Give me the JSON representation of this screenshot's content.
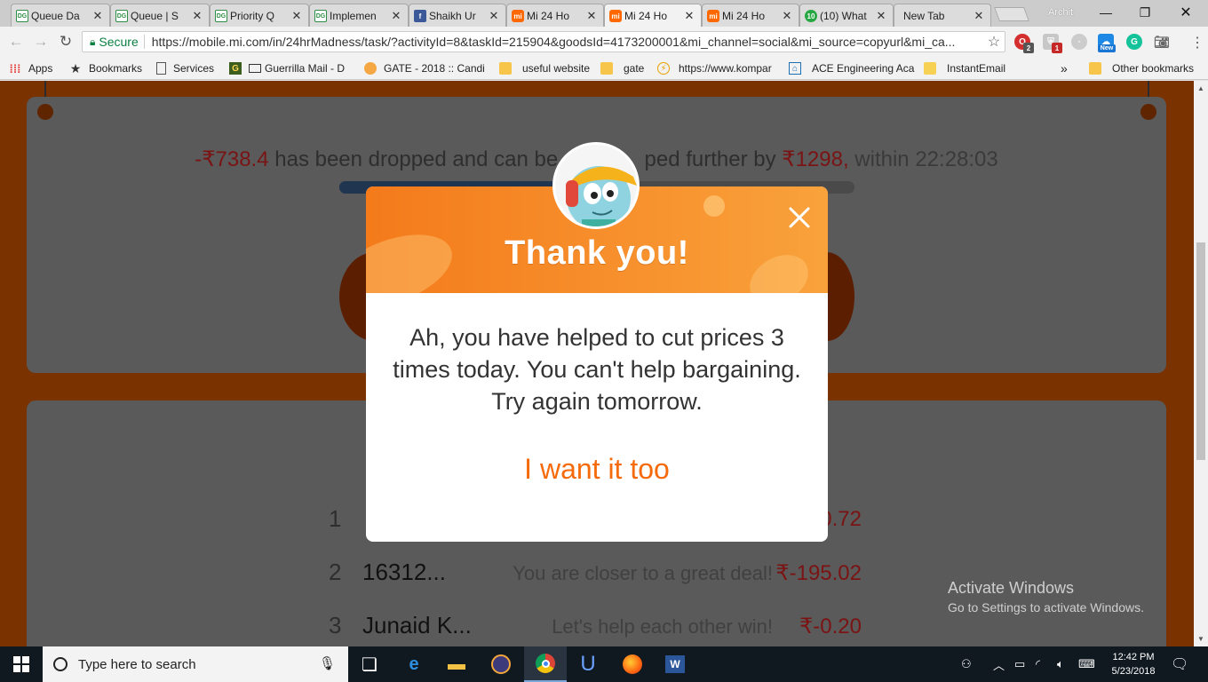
{
  "browser": {
    "tabs": [
      {
        "icon": "gfg-favicon",
        "title": "Queue Da"
      },
      {
        "icon": "gfg-favicon",
        "title": "Queue | S"
      },
      {
        "icon": "gfg-favicon",
        "title": "Priority Q"
      },
      {
        "icon": "gfg-favicon",
        "title": "Implemen"
      },
      {
        "icon": "facebook-favicon",
        "title": "Shaikh Ur"
      },
      {
        "icon": "mi-favicon",
        "title": "Mi 24 Ho"
      },
      {
        "icon": "mi-favicon",
        "title": "Mi 24 Ho",
        "active": true
      },
      {
        "icon": "mi-favicon",
        "title": "Mi 24 Ho"
      },
      {
        "icon": "whatsapp-favicon",
        "title": "(10) What"
      },
      {
        "icon": "none",
        "title": "New Tab"
      }
    ],
    "user": "Archit",
    "security_label": "Secure",
    "url": "https://mobile.mi.com/in/24hrMadness/task/?activityId=8&taskId=215904&goodsId=4173200001&mi_channel=social&mi_source=copyurl&mi_ca...",
    "extension_badges": {
      "opera": "2",
      "shield": "1"
    },
    "extension_new_label": "New",
    "bookmarks": [
      {
        "icon": "apps-icon",
        "label": "Apps"
      },
      {
        "icon": "star-icon",
        "label": "Bookmarks"
      },
      {
        "icon": "page-icon",
        "label": "Services"
      },
      {
        "icon": "g-icon",
        "label": "Guerrilla Mail - D"
      },
      {
        "icon": "gate-icon",
        "label": "GATE - 2018 :: Candi"
      },
      {
        "icon": "folder-icon",
        "label": "useful website"
      },
      {
        "icon": "folder-icon",
        "label": "gate"
      },
      {
        "icon": "bolt-icon",
        "label": "https://www.kompar"
      },
      {
        "icon": "ace-icon",
        "label": "ACE Engineering Aca"
      },
      {
        "icon": "mail-icon",
        "label": "InstantEmail"
      }
    ],
    "bookmarks_overflow": "»",
    "other_bookmarks": "Other bookmarks"
  },
  "page": {
    "drop_amount": "-₹738.4",
    "drop_text_1": "has been dropped and can be",
    "drop_text_2": "ped further by",
    "further_amount": "₹1298,",
    "within_label": "within",
    "countdown": "22:28:03",
    "progress": 0.43,
    "rows": [
      {
        "rank": "1",
        "name": "",
        "msg": "",
        "amount": "0.72"
      },
      {
        "rank": "2",
        "name": "16312...",
        "msg": "You are closer to a great deal!",
        "amount": "₹-195.02"
      },
      {
        "rank": "3",
        "name": "Junaid K...",
        "msg": "Let's help each other win!",
        "amount": "₹-0.20"
      }
    ]
  },
  "modal": {
    "title": "Thank you!",
    "message": "Ah, you have helped to cut prices 3 times today. You can't help bargaining. Try again tomorrow.",
    "action": "I want it too",
    "close_icon": "close-icon"
  },
  "watermark": {
    "line1": "Activate Windows",
    "line2": "Go to Settings to activate Windows."
  },
  "taskbar": {
    "search_placeholder": "Type here to search",
    "time": "12:42 PM",
    "date": "5/23/2018",
    "apps": [
      "task-view-icon",
      "edge-icon",
      "file-explorer-icon",
      "eclipse-icon",
      "chrome-icon",
      "u-app-icon",
      "firefox-icon",
      "word-icon"
    ]
  },
  "colors": {
    "accent_orange": "#f56a0a",
    "page_background": "#7a3200",
    "price_red": "#7a1414"
  }
}
